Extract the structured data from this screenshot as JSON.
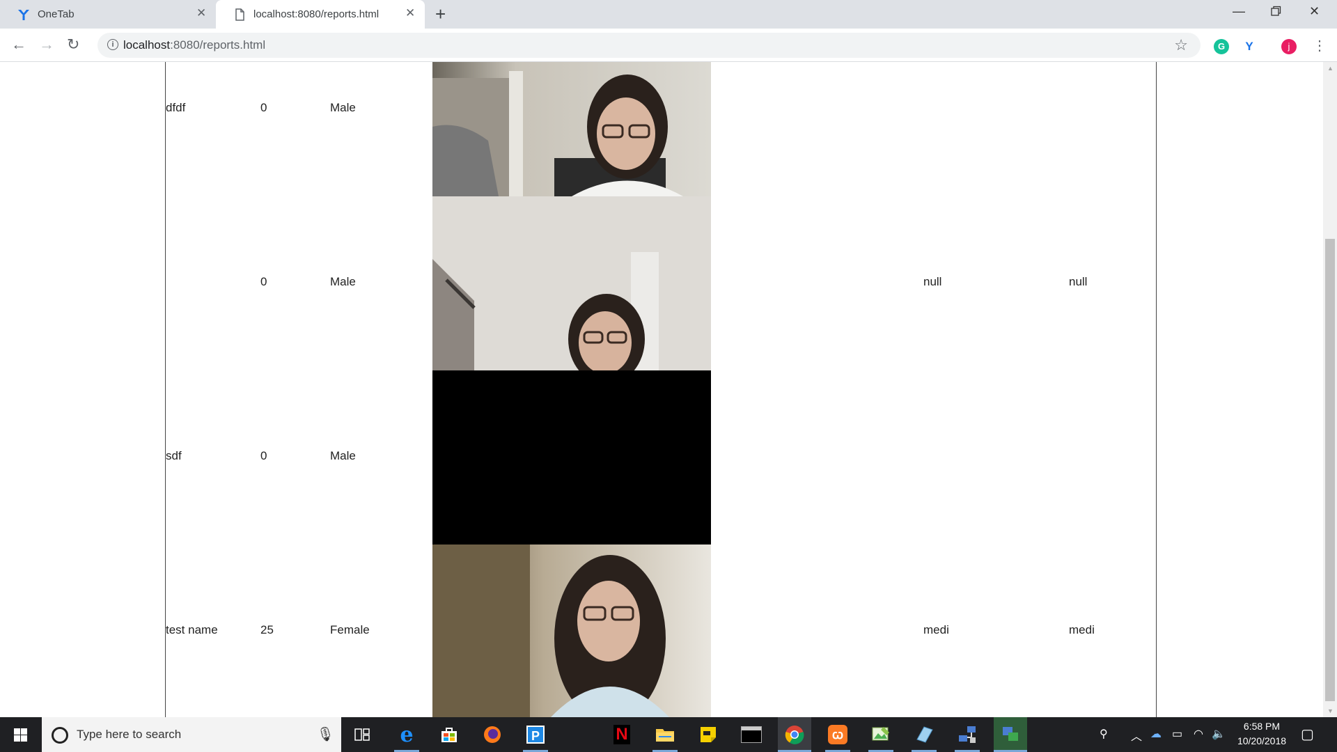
{
  "browser": {
    "tabs": [
      {
        "label": "OneTab",
        "icon": "onetab-icon",
        "active": false
      },
      {
        "label": "localhost:8080/reports.html",
        "icon": "page-icon",
        "active": true
      }
    ],
    "new_tab_icon": "plus-icon",
    "window_controls": [
      "minimize-icon",
      "restore-icon",
      "close-icon"
    ],
    "url_host": "localhost",
    "url_rest": ":8080/reports.html",
    "extensions": [
      {
        "name": "grammarly-icon",
        "letter": "G",
        "color": "#15c39a"
      },
      {
        "name": "onetab-ext-icon",
        "letter": "Y",
        "color": "#1a73e8"
      },
      {
        "name": "profile-avatar",
        "letter": "j",
        "color": "#e91e63"
      }
    ]
  },
  "table": {
    "rows": [
      {
        "name": "dfdf",
        "age": "0",
        "gender": "Male",
        "photo": "webcam-photo-1",
        "col5": "",
        "col6": ""
      },
      {
        "name": "",
        "age": "0",
        "gender": "Male",
        "photo": "webcam-photo-2",
        "col5": "null",
        "col6": "null"
      },
      {
        "name": "sdf",
        "age": "0",
        "gender": "Male",
        "photo": "webcam-photo-black",
        "col5": "",
        "col6": ""
      },
      {
        "name": "test name",
        "age": "25",
        "gender": "Female",
        "photo": "webcam-photo-3",
        "col5": "medi",
        "col6": "medi"
      }
    ]
  },
  "taskbar": {
    "search_placeholder": "Type here to search",
    "apps": [
      "task-view-icon",
      "edge-icon",
      "store-icon",
      "firefox-icon",
      "pandora-icon",
      "netflix-icon",
      "file-explorer-icon",
      "sticky-notes-icon",
      "terminal-icon",
      "chrome-icon",
      "xampp-icon",
      "image-app-icon",
      "notepad-icon",
      "network-app-icon",
      "remote-app-icon"
    ],
    "time": "6:58 PM",
    "date": "10/20/2018"
  },
  "colors": {
    "tab_strip": "#dee1e6",
    "taskbar": "#1f2023",
    "accent_blue": "#0078d7"
  }
}
